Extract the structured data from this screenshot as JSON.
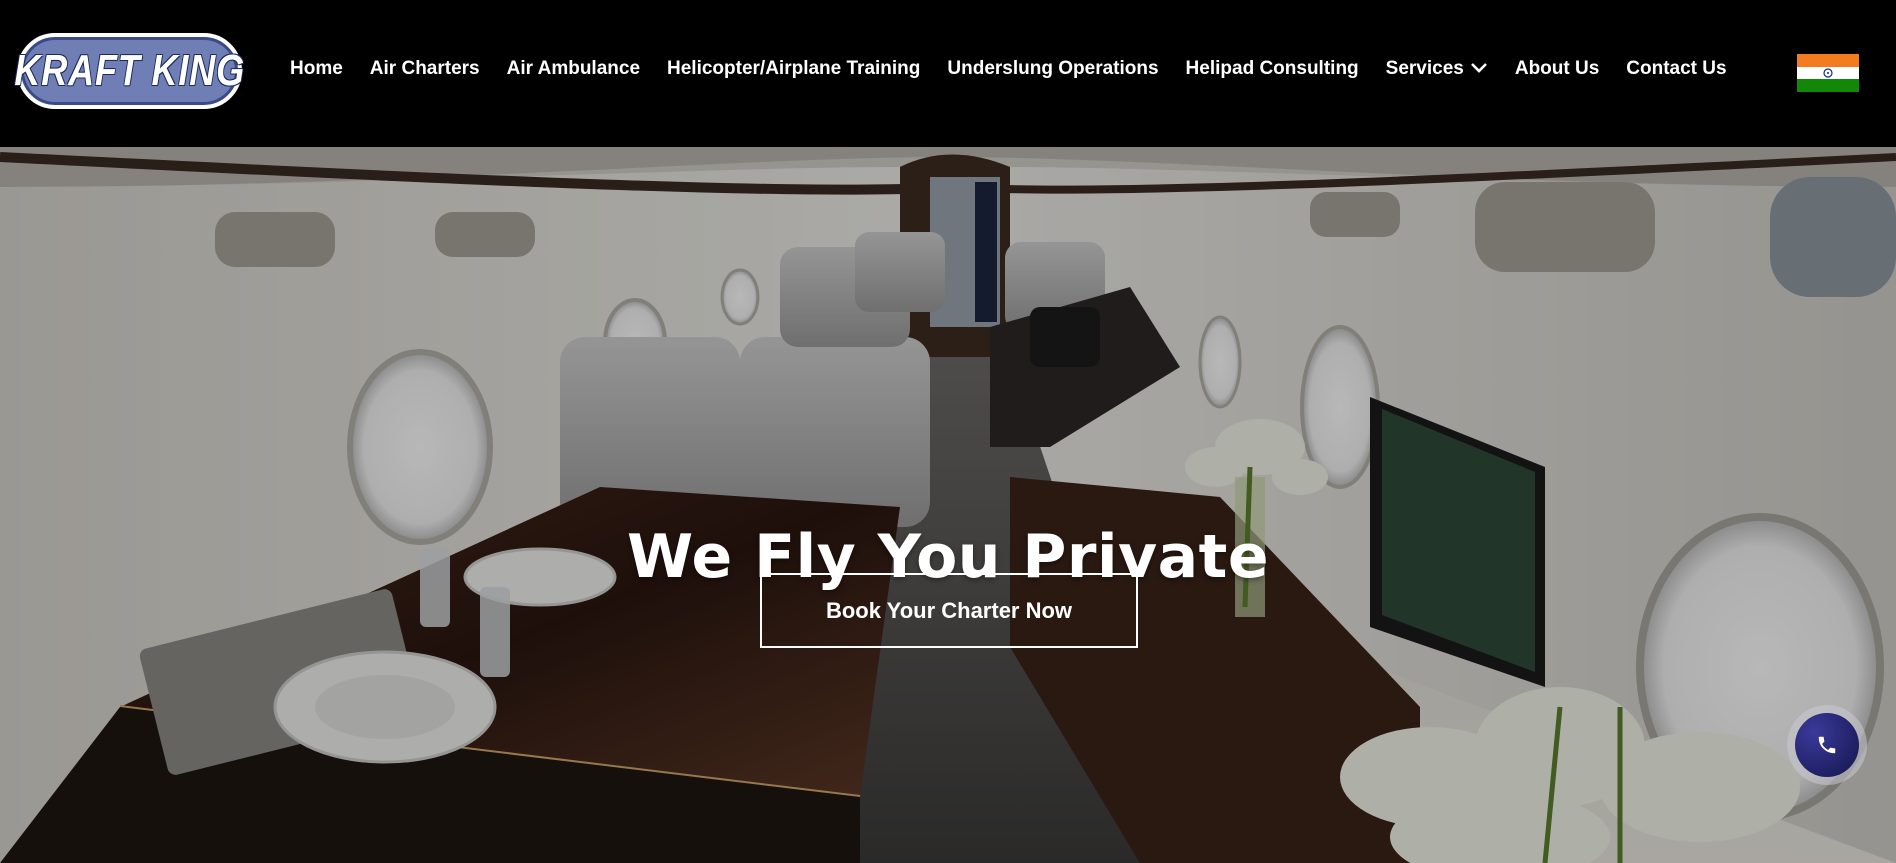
{
  "brand": {
    "logo_text": "KRAFT KING"
  },
  "nav": {
    "items": [
      {
        "label": "Home"
      },
      {
        "label": "Air Charters"
      },
      {
        "label": "Air Ambulance"
      },
      {
        "label": "Helicopter/Airplane Training"
      },
      {
        "label": "Underslung Operations"
      },
      {
        "label": "Helipad Consulting"
      },
      {
        "label": "Services"
      },
      {
        "label": "About Us"
      },
      {
        "label": "Contact Us"
      }
    ],
    "services_icon": "chevron-down-icon",
    "language_flag": "india-flag-icon"
  },
  "hero": {
    "title": "We Fly You Private",
    "cta_label": "Book Your Charter Now",
    "background": "private-jet-cabin-photo"
  },
  "floating": {
    "icon": "phone-icon"
  },
  "colors": {
    "header_bg": "#000000",
    "logo_fill": "#6f7fb6",
    "phone_button": "#1f1f6a",
    "text": "#ffffff"
  }
}
